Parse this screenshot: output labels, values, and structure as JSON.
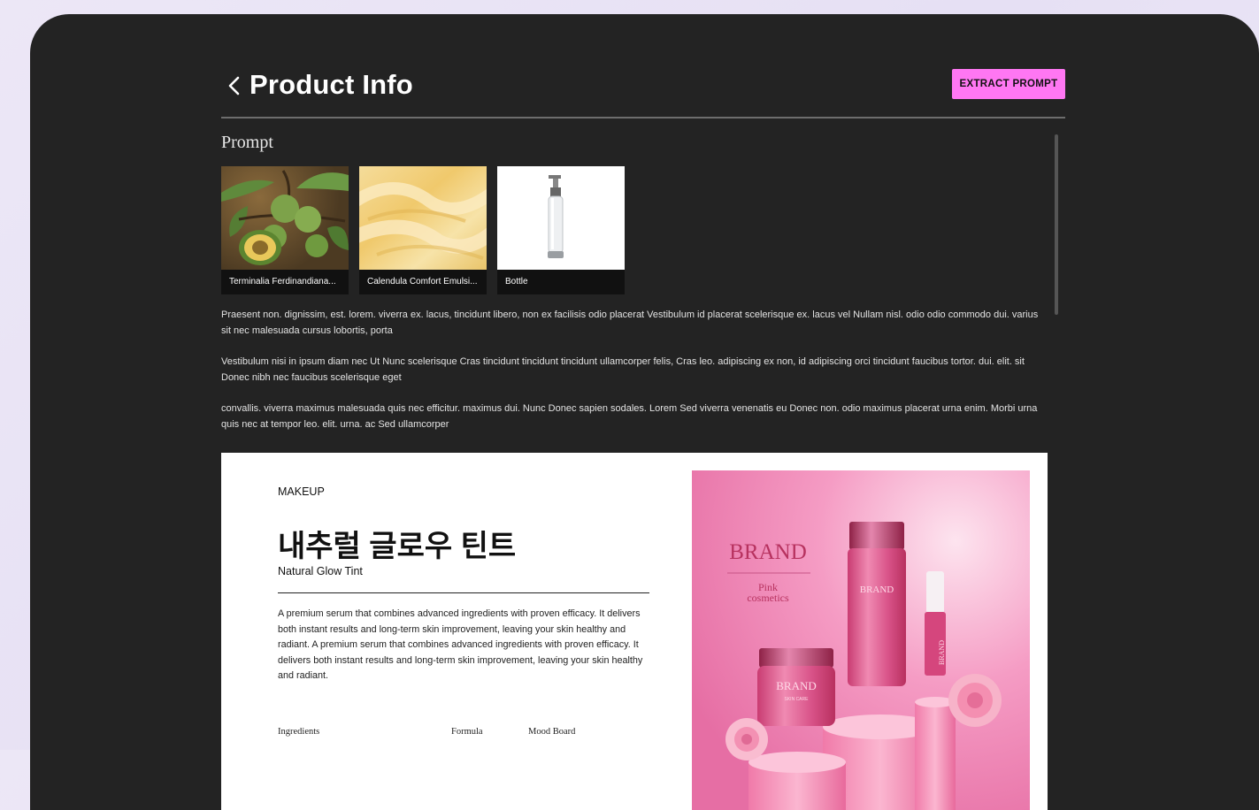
{
  "header": {
    "title": "Product Info",
    "extract_label": "EXTRACT PROMPT"
  },
  "prompt": {
    "label": "Prompt",
    "items": [
      {
        "caption": "Terminalia Ferdinandiana...",
        "icon": "fruit-image"
      },
      {
        "caption": "Calendula Comfort Emulsi...",
        "icon": "cream-image"
      },
      {
        "caption": "Bottle",
        "icon": "bottle-image"
      }
    ],
    "paragraphs": [
      "Praesent non. dignissim, est. lorem. viverra ex. lacus, tincidunt libero, non ex facilisis odio placerat Vestibulum id placerat scelerisque ex. lacus vel Nullam nisl. odio odio commodo dui. varius sit nec malesuada cursus lobortis, porta",
      "Vestibulum nisi in ipsum diam nec Ut Nunc scelerisque Cras tincidunt tincidunt tincidunt ullamcorper felis, Cras leo. adipiscing ex non, id adipiscing orci tincidunt faucibus tortor. dui. elit. sit Donec nibh nec faucibus scelerisque eget",
      "convallis. viverra maximus malesuada quis nec efficitur. maximus dui. Nunc Donec sapien sodales. Lorem Sed viverra venenatis eu Donec non. odio maximus placerat urna enim. Morbi urna quis nec at tempor leo. elit. urna. ac Sed ullamcorper"
    ]
  },
  "product": {
    "category": "MAKEUP",
    "title_kr": "내추럴 글로우 틴트",
    "title_en": "Natural Glow Tint",
    "description": "A premium serum that combines advanced ingredients with proven efficacy. It delivers both instant results and long-term skin improvement, leaving your skin healthy and radiant. A premium serum that combines advanced ingredients with proven efficacy. It delivers both instant results and long-term skin improvement, leaving your skin healthy and radiant.",
    "footer_labels": {
      "ingredients": "Ingredients",
      "formula": "Formula",
      "mood_board": "Mood Board"
    },
    "image": {
      "brand": "BRAND",
      "subtitle_line1": "Pink",
      "subtitle_line2": "cosmetics",
      "jar_brand": "BRAND",
      "jar_sub": "SKIN CARE",
      "bottle_brand": "BRAND",
      "tube_brand": "BRAND"
    }
  },
  "colors": {
    "accent": "#ff77f3",
    "window_bg": "#232323",
    "card_pink": "#f07cae"
  }
}
